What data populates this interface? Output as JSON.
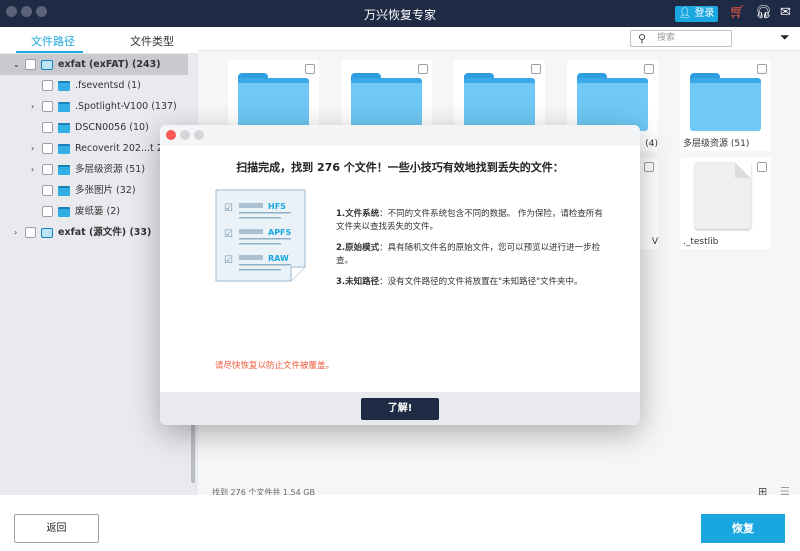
{
  "window": {
    "title": "万兴恢复专家",
    "login_label": "登录"
  },
  "sidebar": {
    "tabs": [
      {
        "label": "文件路径",
        "active": true
      },
      {
        "label": "文件类型",
        "active": false
      }
    ],
    "tree": [
      {
        "label": "exfat (exFAT) (243)",
        "level": 0,
        "expanded": true,
        "selected": true,
        "type": "disk"
      },
      {
        "label": ".fseventsd (1)",
        "level": 1,
        "type": "folder"
      },
      {
        "label": ".Spotlight-V100 (137)",
        "level": 1,
        "expandable": true,
        "type": "folder"
      },
      {
        "label": "DSCN0056 (10)",
        "level": 1,
        "type": "folder"
      },
      {
        "label": "Recoverit 202...t 20.4",
        "level": 1,
        "expandable": true,
        "type": "folder"
      },
      {
        "label": "多层级资源 (51)",
        "level": 1,
        "expandable": true,
        "type": "folder"
      },
      {
        "label": "多张图片 (32)",
        "level": 1,
        "type": "folder"
      },
      {
        "label": "废纸篓 (2)",
        "level": 1,
        "type": "folder"
      },
      {
        "label": "exfat (源文件) (33)",
        "level": 0,
        "expandable": true,
        "type": "disk"
      }
    ]
  },
  "main": {
    "search_placeholder": "搜索",
    "cards": [
      {
        "label": "",
        "type": "folder"
      },
      {
        "label": "",
        "type": "folder"
      },
      {
        "label": "",
        "type": "folder"
      },
      {
        "label": "(4)",
        "type": "folder"
      },
      {
        "label": "多层级资源 (51)",
        "type": "folder"
      },
      {
        "label": "V",
        "type": "file"
      },
      {
        "label": "._testlib",
        "type": "file"
      }
    ],
    "status": "找到 276 个文件共 1.54 GB"
  },
  "dialog": {
    "heading": "扫描完成，找到 276 个文件！一些小技巧有效地找到丢失的文件：",
    "illustration": {
      "items": [
        "HFS",
        "APFS",
        "RAW"
      ]
    },
    "tips": [
      {
        "title": "1.文件系统",
        "text": "：不同的文件系统包含不同的数据。 作为保险，请检查所有文件夹以查找丢失的文件。"
      },
      {
        "title": "2.原始模式",
        "text": "：具有随机文件名的原始文件，您可以预览以进行进一步检查。"
      },
      {
        "title": "3.未知路径",
        "text": "：没有文件路径的文件将放置在\"未知路径\"文件夹中。"
      }
    ],
    "warning": "请尽快恢复以防止文件被覆盖。",
    "ok_label": "了解!"
  },
  "footer": {
    "back_label": "返回",
    "recover_label": "恢复"
  },
  "colors": {
    "titlebar": "#1f2a44",
    "accent": "#1aa7e0",
    "warning": "#f05a3c",
    "cart": "#f05a3c"
  }
}
